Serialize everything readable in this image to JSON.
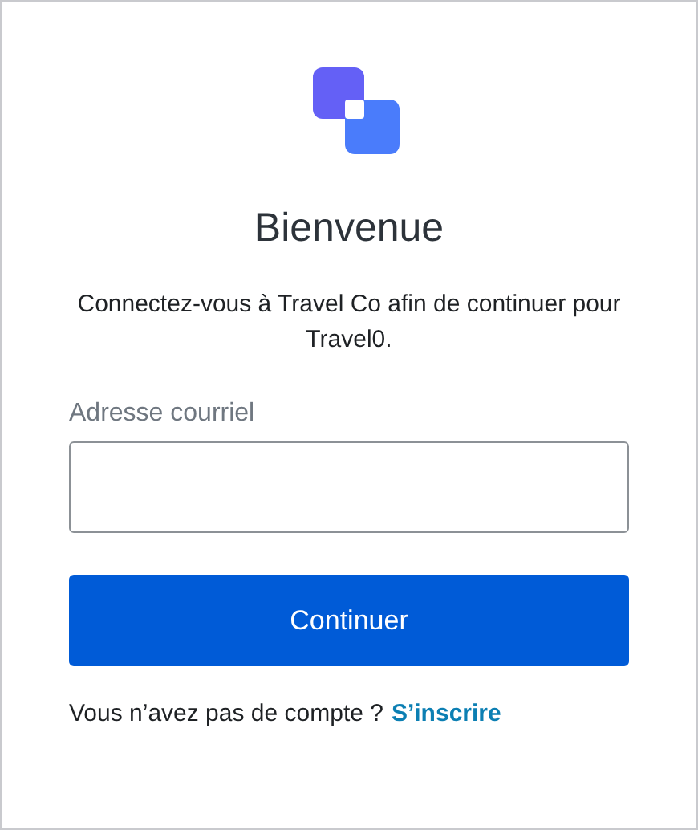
{
  "title": "Bienvenue",
  "description": "Connectez-vous à Travel Co afin de continuer pour Travel0.",
  "email_field": {
    "label": "Adresse courriel"
  },
  "continue_button": "Continuer",
  "signup": {
    "prompt": "Vous n’avez pas de compte ?",
    "link": "S’inscrire"
  }
}
